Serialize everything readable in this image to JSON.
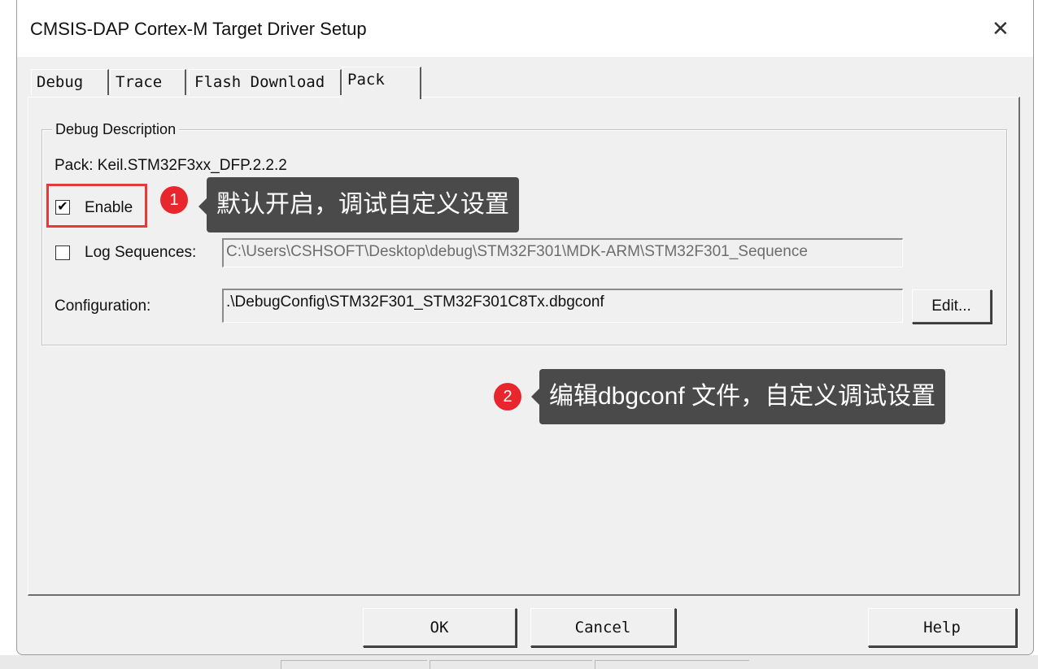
{
  "window": {
    "title": "CMSIS-DAP Cortex-M Target Driver Setup",
    "close_glyph": "✕"
  },
  "tabs": [
    {
      "label": "Debug"
    },
    {
      "label": "Trace"
    },
    {
      "label": "Flash Download"
    },
    {
      "label": "Pack",
      "selected": true
    }
  ],
  "debug_description": {
    "group_title": "Debug Description",
    "pack_text": "Pack: Keil.STM32F3xx_DFP.2.2.2",
    "enable": {
      "label": "Enable",
      "checked": true,
      "check_glyph": "✔"
    },
    "log_sequences": {
      "label": "Log Sequences:",
      "checked": false,
      "value": "C:\\Users\\CSHSOFT\\Desktop\\debug\\STM32F301\\MDK-ARM\\STM32F301_Sequence"
    },
    "configuration": {
      "label": "Configuration:",
      "value": ".\\DebugConfig\\STM32F301_STM32F301C8Tx.dbgconf",
      "edit_label": "Edit..."
    }
  },
  "footer": {
    "ok_label": "OK",
    "cancel_label": "Cancel",
    "help_label": "Help"
  },
  "annotations": {
    "callout1": {
      "badge": "1",
      "text": "默认开启，调试自定义设置"
    },
    "callout2": {
      "badge": "2",
      "text": "编辑dbgconf 文件，自定义调试设置"
    }
  },
  "colors": {
    "highlight_red": "#e53a3a",
    "badge_red": "#e8262d",
    "callout_bg": "#4a4a4a",
    "window_bg": "#f0f0f0"
  }
}
